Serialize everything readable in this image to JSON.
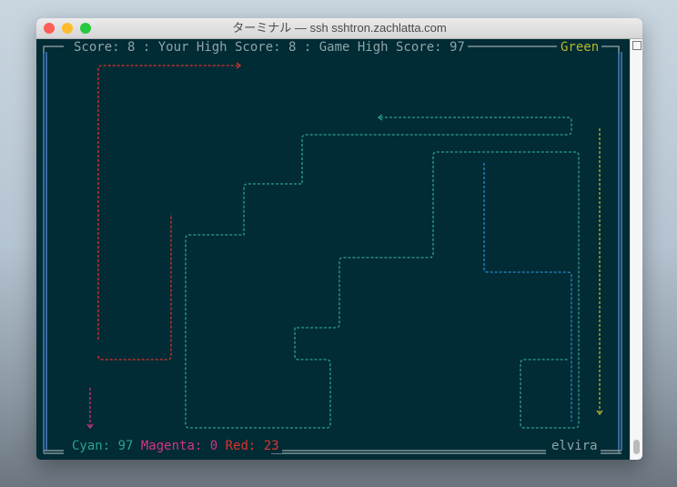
{
  "window": {
    "title": "ターミナル — ssh sshtron.zachlatta.com"
  },
  "header": {
    "score_label": "Score: 8 : Your High Score: 8 : Game High Score: 97",
    "player_color": "Green"
  },
  "footer": {
    "cyan": "Cyan: 97",
    "magenta": "Magenta: 0",
    "red": "Red: 23",
    "player_name": "elvira"
  },
  "colors": {
    "cyan": "#2aa198",
    "blue": "#268bd2",
    "magenta": "#d33682",
    "red": "#dc322f",
    "green": "#b5b82a",
    "frame": "#93a1a1",
    "background": "#002b36"
  }
}
